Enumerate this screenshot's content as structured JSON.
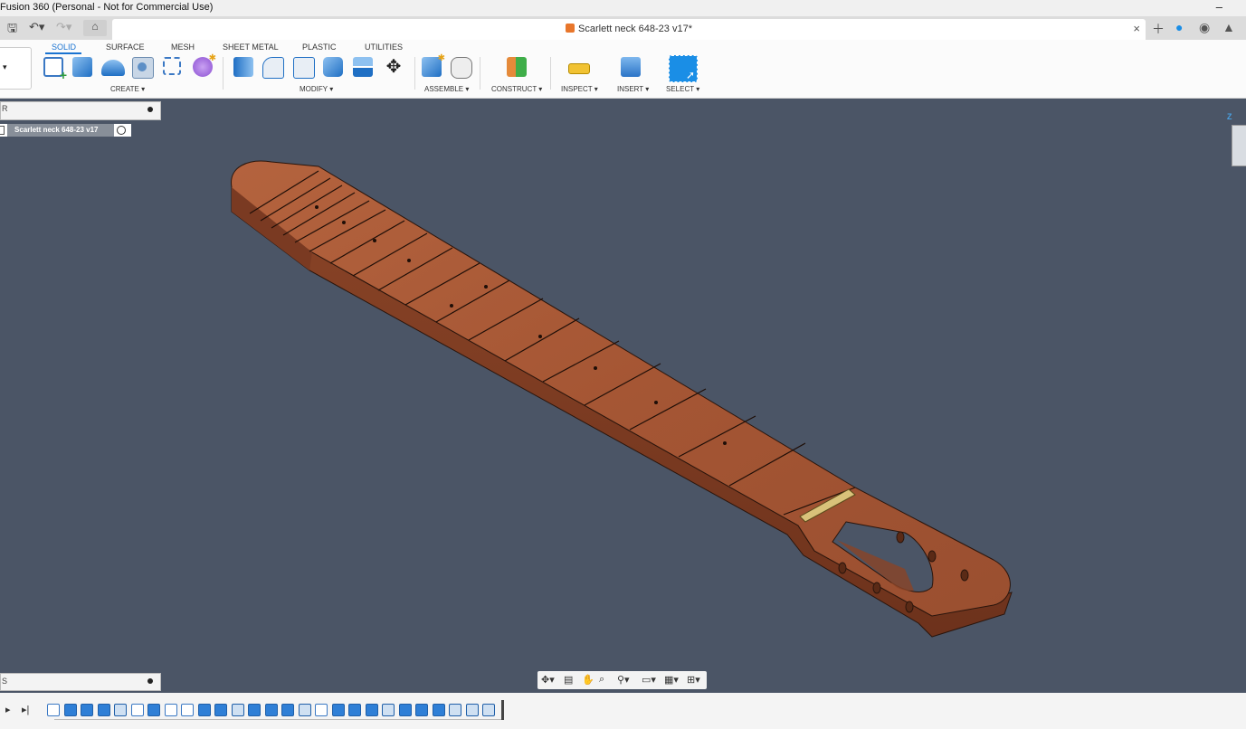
{
  "window": {
    "title": "Fusion 360 (Personal - Not for Commercial Use)",
    "minimize": "–"
  },
  "document_tab": {
    "name": "Scarlett neck 648-23 v17*"
  },
  "tabs": [
    "SOLID",
    "SURFACE",
    "MESH",
    "SHEET METAL",
    "PLASTIC",
    "UTILITIES"
  ],
  "groups": {
    "create": "CREATE ▾",
    "modify": "MODIFY ▾",
    "assemble": "ASSEMBLE ▾",
    "construct": "CONSTRUCT ▾",
    "inspect": "INSPECT ▾",
    "insert": "INSERT ▾",
    "select": "SELECT ▾"
  },
  "browser": {
    "label": "R",
    "component": "Scarlett neck 648-23 v17"
  },
  "comments": {
    "label": "S"
  },
  "viewcube": {
    "axis": "Z"
  },
  "colors": {
    "viewport": "#4b5566",
    "wood": "#9a5032",
    "accent": "#1a73d1"
  }
}
